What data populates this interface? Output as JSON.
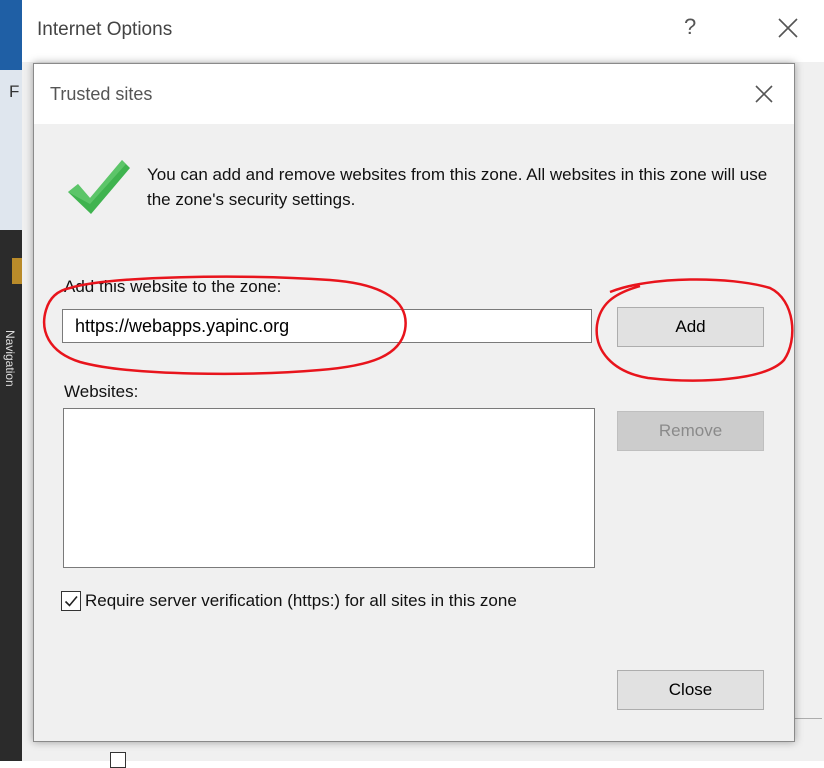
{
  "background_window": {
    "title": "Internet Options",
    "help_label": "?",
    "left_strip_letter": "F",
    "left_strip_nav_text": "Navigation"
  },
  "dialog": {
    "title": "Trusted sites",
    "intro_text": "You can add and remove websites from this zone. All websites in this zone will use the zone's security settings.",
    "add_label": "Add this website to the zone:",
    "url_value": "https://webapps.yapinc.org",
    "add_button": "Add",
    "websites_label": "Websites:",
    "websites": [],
    "remove_button": "Remove",
    "verify_label": "Require server verification (https:) for all sites in this zone",
    "verify_checked": true,
    "close_button": "Close"
  },
  "colors": {
    "check_icon": "#3fb34f",
    "annotation": "#e8141c"
  },
  "icons": {
    "dialog_check": "check-icon",
    "close": "close-icon"
  }
}
